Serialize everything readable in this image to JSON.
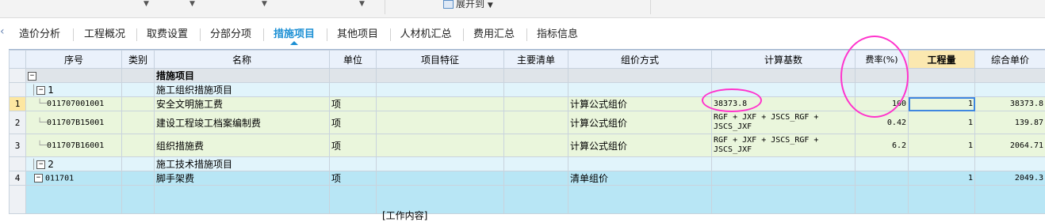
{
  "toolbar": {
    "expand_label": "展开到"
  },
  "tabs": [
    {
      "label": "造价分析"
    },
    {
      "label": "工程概况"
    },
    {
      "label": "取费设置"
    },
    {
      "label": "分部分项"
    },
    {
      "label": "措施项目"
    },
    {
      "label": "其他项目"
    },
    {
      "label": "人材机汇总"
    },
    {
      "label": "费用汇总"
    },
    {
      "label": "指标信息"
    }
  ],
  "active_tab": "措施项目",
  "columns": [
    "序号",
    "类别",
    "名称",
    "单位",
    "项目特征",
    "主要清单",
    "组价方式",
    "计算基数",
    "费率(%)",
    "工程量",
    "综合单价"
  ],
  "rows": [
    {
      "rownum": "",
      "code": "",
      "type": "",
      "name": "措施项目",
      "unit": "",
      "feature": "",
      "main": "",
      "method": "",
      "base": "",
      "rate": "",
      "qty": "",
      "price": ""
    },
    {
      "rownum": "",
      "code": "1",
      "type": "",
      "name": "施工组织措施项目",
      "unit": "",
      "feature": "",
      "main": "",
      "method": "",
      "base": "",
      "rate": "",
      "qty": "",
      "price": ""
    },
    {
      "rownum": "1",
      "code": "011707001001",
      "type": "",
      "name": "安全文明施工费",
      "unit": "项",
      "feature": "",
      "main": "",
      "method": "计算公式组价",
      "base": "38373.8",
      "rate": "100",
      "qty": "1",
      "price": "38373.8"
    },
    {
      "rownum": "2",
      "code": "011707B15001",
      "type": "",
      "name": "建设工程竣工档案编制费",
      "unit": "项",
      "feature": "",
      "main": "",
      "method": "计算公式组价",
      "base": "RGF + JXF + JSCS_RGF + JSCS_JXF",
      "rate": "0.42",
      "qty": "1",
      "price": "139.87"
    },
    {
      "rownum": "3",
      "code": "011707B16001",
      "type": "",
      "name": "组织措施费",
      "unit": "项",
      "feature": "",
      "main": "",
      "method": "计算公式组价",
      "base": "RGF + JXF + JSCS_RGF + JSCS_JXF",
      "rate": "6.2",
      "qty": "1",
      "price": "2064.71"
    },
    {
      "rownum": "",
      "code": "2",
      "type": "",
      "name": "施工技术措施项目",
      "unit": "",
      "feature": "",
      "main": "",
      "method": "",
      "base": "",
      "rate": "",
      "qty": "",
      "price": ""
    },
    {
      "rownum": "4",
      "code": "011701",
      "type": "",
      "name": "脚手架费",
      "unit": "项",
      "feature": "",
      "main": "",
      "method": "清单组价",
      "base": "",
      "rate": "",
      "qty": "1",
      "price": "2049.3"
    }
  ],
  "bottom_text": "[工作内容]"
}
